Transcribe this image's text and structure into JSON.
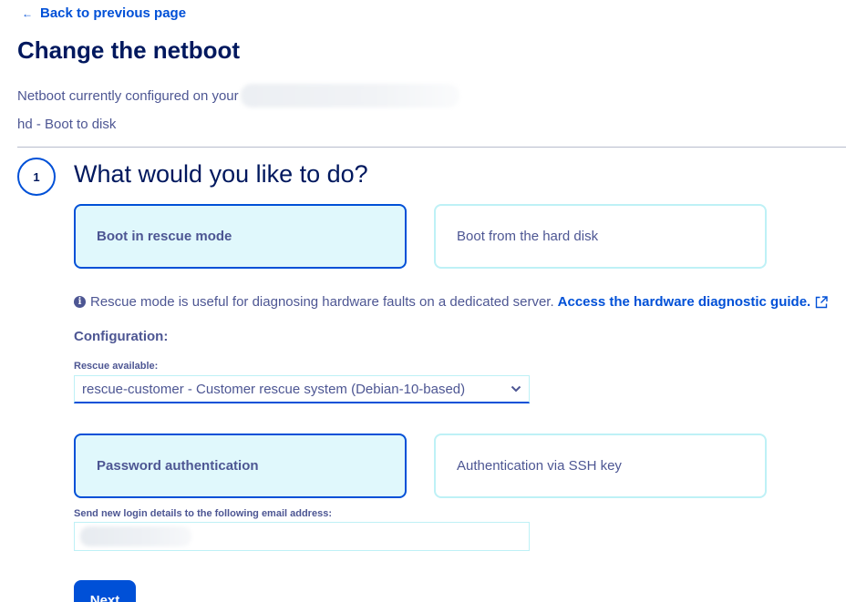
{
  "nav": {
    "back_arrow": "←",
    "back_label": "Back to previous page"
  },
  "page": {
    "title": "Change the netboot",
    "current_prefix": "Netboot currently configured on your",
    "current_value": "hd - Boot to disk"
  },
  "step": {
    "number": "1",
    "title": "What would you like to do?"
  },
  "boot_options": [
    {
      "label": "Boot in rescue mode",
      "selected": true
    },
    {
      "label": "Boot from the hard disk",
      "selected": false
    }
  ],
  "info": {
    "icon": "info-circle-icon",
    "text": "Rescue mode is useful for diagnosing hardware faults on a dedicated server.",
    "link_label": "Access the hardware diagnostic guide.",
    "link_icon": "external-link-icon"
  },
  "configuration": {
    "heading": "Configuration:",
    "rescue_label": "Rescue available:",
    "rescue_value": "rescue-customer - Customer rescue system (Debian-10-based)"
  },
  "auth_options": [
    {
      "label": "Password authentication",
      "selected": true
    },
    {
      "label": "Authentication via SSH key",
      "selected": false
    }
  ],
  "email": {
    "label": "Send new login details to the following email address:"
  },
  "actions": {
    "next_label": "Next"
  },
  "colors": {
    "primary": "#0050d7",
    "title": "#00185e",
    "text": "#4d5693",
    "tile_selected_bg": "#e0f8fc",
    "tile_border": "#bef1f6"
  }
}
